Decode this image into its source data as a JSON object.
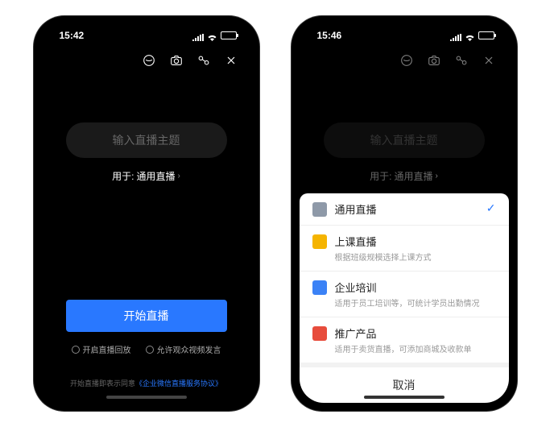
{
  "status": {
    "time_left": "15:42",
    "time_right": "15:46"
  },
  "top_icons": {
    "beauty": "beauty-icon",
    "camera": "camera-icon",
    "share": "share-icon",
    "close": "close-icon"
  },
  "subject_placeholder": "输入直播主题",
  "purpose_prefix": "用于:",
  "purpose_value": "通用直播",
  "start_button": "开始直播",
  "options": {
    "replay": "开启直播回放",
    "speak": "允许观众视频发言"
  },
  "agreement_prefix": "开始直播即表示同意",
  "agreement_link": "《企业微信直播服务协议》",
  "sheet": {
    "items": [
      {
        "icon_color": "#8e99a8",
        "title": "通用直播",
        "sub": "",
        "checked": true
      },
      {
        "icon_color": "#f5b400",
        "title": "上课直播",
        "sub": "根据班级规模选择上课方式",
        "checked": false
      },
      {
        "icon_color": "#3b82f6",
        "title": "企业培训",
        "sub": "适用于员工培训等，可统计学员出勤情况",
        "checked": false
      },
      {
        "icon_color": "#e74c3c",
        "title": "推广产品",
        "sub": "适用于卖货直播，可添加商城及收款单",
        "checked": false
      }
    ],
    "cancel": "取消"
  }
}
